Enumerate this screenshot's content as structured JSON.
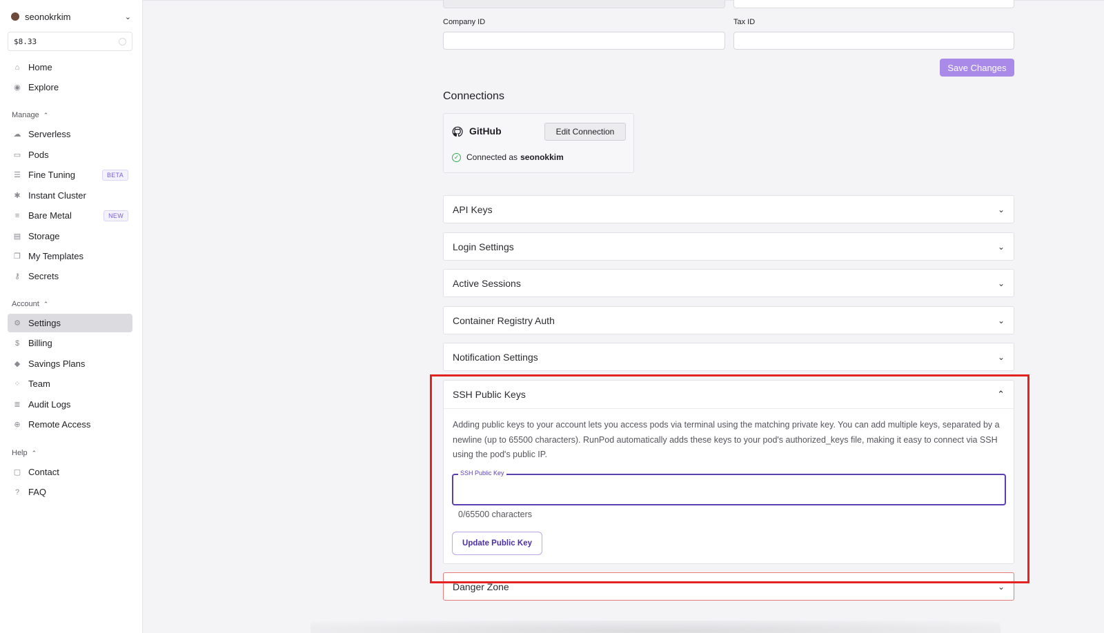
{
  "sidebar": {
    "user": {
      "name": "seonokrkim"
    },
    "balance": "$8.33",
    "top_items": [
      {
        "label": "Home",
        "icon": "home-icon"
      },
      {
        "label": "Explore",
        "icon": "compass-icon"
      }
    ],
    "manage": {
      "heading": "Manage",
      "items": [
        {
          "label": "Serverless",
          "icon": "cloud-icon"
        },
        {
          "label": "Pods",
          "icon": "pod-icon"
        },
        {
          "label": "Fine Tuning",
          "icon": "sliders-icon",
          "badge": "BETA"
        },
        {
          "label": "Instant Cluster",
          "icon": "cluster-icon"
        },
        {
          "label": "Bare Metal",
          "icon": "server-icon",
          "badge": "NEW"
        },
        {
          "label": "Storage",
          "icon": "folder-icon"
        },
        {
          "label": "My Templates",
          "icon": "template-icon"
        },
        {
          "label": "Secrets",
          "icon": "key-icon"
        }
      ]
    },
    "account": {
      "heading": "Account",
      "items": [
        {
          "label": "Settings",
          "icon": "gear-icon",
          "active": true
        },
        {
          "label": "Billing",
          "icon": "dollar-icon"
        },
        {
          "label": "Savings Plans",
          "icon": "tag-icon"
        },
        {
          "label": "Team",
          "icon": "team-icon"
        },
        {
          "label": "Audit Logs",
          "icon": "audit-icon"
        },
        {
          "label": "Remote Access",
          "icon": "globe-icon"
        }
      ]
    },
    "help": {
      "heading": "Help",
      "items": [
        {
          "label": "Contact",
          "icon": "chat-icon"
        },
        {
          "label": "FAQ",
          "icon": "question-icon"
        }
      ]
    }
  },
  "form": {
    "company_id_label": "Company ID",
    "tax_id_label": "Tax ID",
    "company_id_value": "",
    "tax_id_value": "",
    "save_label": "Save Changes"
  },
  "connections": {
    "title": "Connections",
    "provider": "GitHub",
    "edit_label": "Edit Connection",
    "status_prefix": "Connected as",
    "username": "seonokkim"
  },
  "accordions": [
    {
      "label": "API Keys"
    },
    {
      "label": "Login Settings"
    },
    {
      "label": "Active Sessions"
    },
    {
      "label": "Container Registry Auth"
    },
    {
      "label": "Notification Settings"
    }
  ],
  "ssh": {
    "title": "SSH Public Keys",
    "description": "Adding public keys to your account lets you access pods via terminal using the matching private key. You can add multiple keys, separated by a newline (up to 65500 characters). RunPod automatically adds these keys to your pod's authorized_keys file, making it easy to connect via SSH using the pod's public IP.",
    "field_label": "SSH Public Key",
    "field_value": "",
    "char_count": "0/65500 characters",
    "update_label": "Update Public Key"
  },
  "danger_zone": {
    "label": "Danger Zone"
  },
  "colors": {
    "accent": "#a98ae9",
    "focus": "#5b3fb2",
    "highlight": "#e52222",
    "success": "#2fae4d",
    "danger_border": "#e87c7c"
  }
}
